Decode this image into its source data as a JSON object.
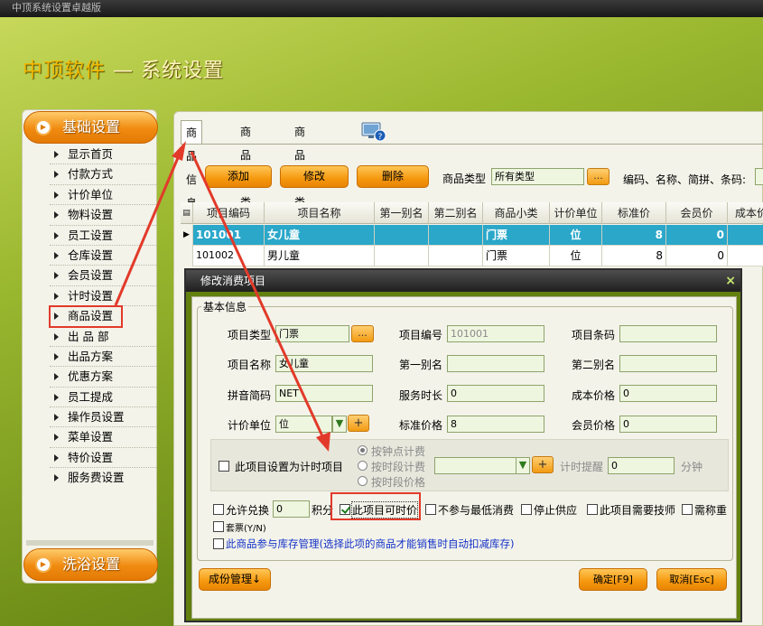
{
  "window": {
    "title": "中顶系统设置卓越版"
  },
  "app": {
    "brand": "中顶软件",
    "dash": " — ",
    "title": "系统设置"
  },
  "sidebar": {
    "header": "基础设置",
    "items": [
      {
        "label": "显示首页"
      },
      {
        "label": "付款方式"
      },
      {
        "label": "计价单位"
      },
      {
        "label": "物料设置"
      },
      {
        "label": "员工设置"
      },
      {
        "label": "仓库设置"
      },
      {
        "label": "会员设置"
      },
      {
        "label": "计时设置"
      },
      {
        "label": "商品设置",
        "selected": true
      },
      {
        "label": "出 品 部"
      },
      {
        "label": "出品方案"
      },
      {
        "label": "优惠方案"
      },
      {
        "label": "员工提成"
      },
      {
        "label": "操作员设置"
      },
      {
        "label": "菜单设置"
      },
      {
        "label": "特价设置"
      },
      {
        "label": "服务费设置"
      }
    ],
    "footer": "洗浴设置"
  },
  "tabs": [
    {
      "label": "商品信息",
      "active": true
    },
    {
      "label": "商品大类"
    },
    {
      "label": "商品小类"
    }
  ],
  "toolbar": {
    "add": "添加",
    "edit": "修改",
    "delete": "删除",
    "type_label": "商品类型",
    "type_value": "所有类型",
    "dots": "...",
    "search_label": "编码、名称、简拼、条码:"
  },
  "grid": {
    "columns": [
      "项目编码",
      "项目名称",
      "第一别名",
      "第二别名",
      "商品小类",
      "计价单位",
      "标准价",
      "会员价",
      "成本价"
    ],
    "rows": [
      [
        "101001",
        "女儿童",
        "",
        "",
        "门票",
        "位",
        "8",
        "0",
        ""
      ],
      [
        "101002",
        "男儿童",
        "",
        "",
        "门票",
        "位",
        "8",
        "0",
        ""
      ]
    ]
  },
  "dialog": {
    "title": "修改消费项目",
    "close": "×",
    "group": "基本信息",
    "fields": {
      "item_type_label": "项目类型",
      "item_type": "门票",
      "item_code_label": "项目编号",
      "item_code": "101001",
      "barcode_label": "项目条码",
      "barcode": "",
      "item_name_label": "项目名称",
      "item_name": "女儿童",
      "alias1_label": "第一别名",
      "alias1": "",
      "alias2_label": "第二别名",
      "alias2": "",
      "pinyin_label": "拼音简码",
      "pinyin": "NET",
      "duration_label": "服务时长",
      "duration": "0",
      "cost_label": "成本价格",
      "cost": "0",
      "unit_label": "计价单位",
      "unit": "位",
      "std_price_label": "标准价格",
      "std_price": "8",
      "member_price_label": "会员价格",
      "member_price": "0"
    },
    "timing": {
      "checkbox": "此项目设置为计时项目",
      "radio1": "按钟点计费",
      "radio2": "按时段计费",
      "radio3": "按时段价格",
      "remind_label": "计时提醒",
      "remind": "0",
      "unit": "分钟"
    },
    "options": {
      "exchange": "允许兑换",
      "points": "0",
      "points_unit": "积分",
      "timed_price": "此项目可时价",
      "no_min": "不参与最低消费",
      "stop": "停止供应",
      "need_tech": "此项目需要技师",
      "weigh": "需称重",
      "set": "套票(Y/N)",
      "inventory": "此商品参与库存管理(选择此项的商品才能销售时自动扣减库存)"
    },
    "buttons": {
      "cost_mgmt": "成份管理↓",
      "ok": "确定[F9]",
      "cancel": "取消[Esc]"
    }
  },
  "colors": {
    "accent": "#f39a12",
    "selection": "#2aa7c9",
    "annotation": "#e23a2a"
  }
}
